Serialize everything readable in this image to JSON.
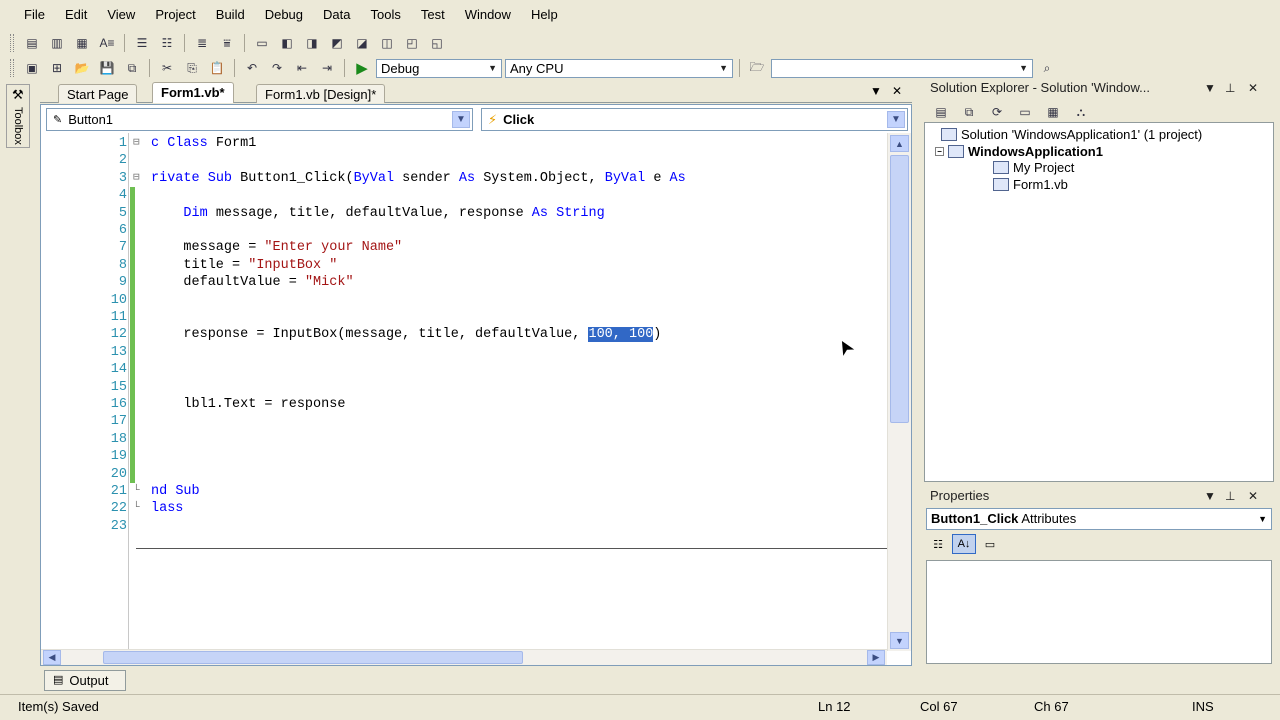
{
  "menu": [
    "File",
    "Edit",
    "View",
    "Project",
    "Build",
    "Debug",
    "Data",
    "Tools",
    "Test",
    "Window",
    "Help"
  ],
  "toolbar": {
    "configuration": "Debug",
    "platform": "Any CPU",
    "find_value": ""
  },
  "doc_tabs": {
    "start_page": "Start Page",
    "form1_vb": "Form1.vb*",
    "form1_design": "Form1.vb [Design]*"
  },
  "toolbox_label": "Toolbox",
  "editor": {
    "object_combo": "Button1",
    "event_combo": "Click",
    "lines": [
      {
        "n": "1",
        "parts": [
          {
            "t": "c ",
            "c": "kw"
          },
          {
            "t": "Class",
            "c": "kw"
          },
          {
            "t": " Form1",
            "c": ""
          }
        ]
      },
      {
        "n": "2",
        "parts": []
      },
      {
        "n": "3",
        "parts": [
          {
            "t": "rivate ",
            "c": "kw"
          },
          {
            "t": "Sub",
            "c": "kw"
          },
          {
            "t": " Button1_Click(",
            "c": ""
          },
          {
            "t": "ByVal",
            "c": "kw"
          },
          {
            "t": " sender ",
            "c": ""
          },
          {
            "t": "As",
            "c": "kw"
          },
          {
            "t": " System.Object, ",
            "c": ""
          },
          {
            "t": "ByVal",
            "c": "kw"
          },
          {
            "t": " e ",
            "c": ""
          },
          {
            "t": "As",
            "c": "kw"
          }
        ]
      },
      {
        "n": "4",
        "parts": []
      },
      {
        "n": "5",
        "parts": [
          {
            "t": "    ",
            "c": ""
          },
          {
            "t": "Dim",
            "c": "kw"
          },
          {
            "t": " message, title, defaultValue, response ",
            "c": ""
          },
          {
            "t": "As",
            "c": "kw"
          },
          {
            "t": " ",
            "c": ""
          },
          {
            "t": "String",
            "c": "kw"
          }
        ]
      },
      {
        "n": "6",
        "parts": []
      },
      {
        "n": "7",
        "parts": [
          {
            "t": "    message = ",
            "c": ""
          },
          {
            "t": "\"Enter your Name\"",
            "c": "str"
          }
        ]
      },
      {
        "n": "8",
        "parts": [
          {
            "t": "    title = ",
            "c": ""
          },
          {
            "t": "\"InputBox \"",
            "c": "str"
          }
        ]
      },
      {
        "n": "9",
        "parts": [
          {
            "t": "    defaultValue = ",
            "c": ""
          },
          {
            "t": "\"Mick\"",
            "c": "str"
          }
        ]
      },
      {
        "n": "10",
        "parts": []
      },
      {
        "n": "11",
        "parts": []
      },
      {
        "n": "12",
        "parts": [
          {
            "t": "    response = InputBox(message, title, defaultValue, ",
            "c": ""
          },
          {
            "t": "100, 100",
            "c": "sel"
          },
          {
            "t": ")",
            "c": ""
          }
        ]
      },
      {
        "n": "13",
        "parts": []
      },
      {
        "n": "14",
        "parts": []
      },
      {
        "n": "15",
        "parts": []
      },
      {
        "n": "16",
        "parts": [
          {
            "t": "    lbl1.Text = response",
            "c": ""
          }
        ]
      },
      {
        "n": "17",
        "parts": []
      },
      {
        "n": "18",
        "parts": []
      },
      {
        "n": "19",
        "parts": []
      },
      {
        "n": "20",
        "parts": []
      },
      {
        "n": "21",
        "parts": [
          {
            "t": "nd ",
            "c": "kw"
          },
          {
            "t": "Sub",
            "c": "kw"
          }
        ]
      },
      {
        "n": "22",
        "parts": [
          {
            "t": "lass",
            "c": "kw"
          }
        ]
      },
      {
        "n": "23",
        "parts": []
      }
    ]
  },
  "solution_explorer": {
    "title": "Solution Explorer - Solution 'Window...",
    "solution": "Solution 'WindowsApplication1' (1 project)",
    "project": "WindowsApplication1",
    "my_project": "My Project",
    "form1": "Form1.vb"
  },
  "properties": {
    "title": "Properties",
    "object_name": "Button1_Click",
    "object_type": "Attributes"
  },
  "output_tab": "Output",
  "status": {
    "message": "Item(s) Saved",
    "ln": "Ln 12",
    "col": "Col 67",
    "ch": "Ch 67",
    "mode": "INS"
  }
}
